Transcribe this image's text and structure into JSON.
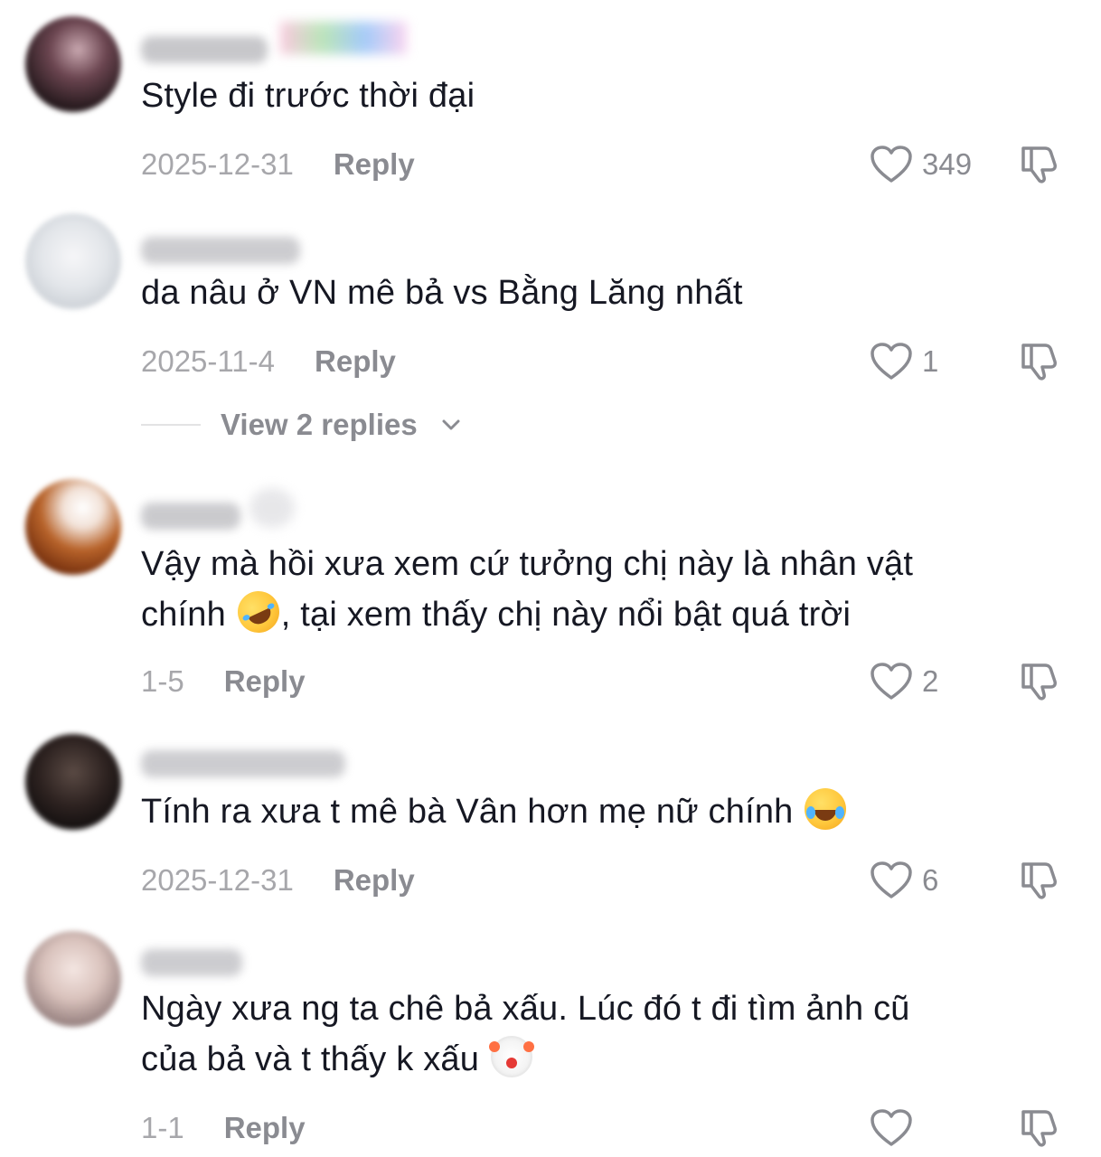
{
  "comments": [
    {
      "text": "Style đi trước thời đại",
      "date": "2025-12-31",
      "reply_label": "Reply",
      "likes": "349"
    },
    {
      "text": "da nâu ở VN mê bả vs Bằng Lăng nhất",
      "date": "2025-11-4",
      "reply_label": "Reply",
      "likes": "1",
      "view_replies": "View 2 replies"
    },
    {
      "text_line1": "Vậy mà hồi xưa xem cứ tưởng chị này là nhân vật",
      "text_line2a": "chính ",
      "text_line2b": ", tại xem thấy chị này nổi bật quá trời",
      "emoji": "rolling-on-floor-laughing",
      "date": "1-5",
      "reply_label": "Reply",
      "likes": "2"
    },
    {
      "text": "Tính ra xưa t mê bà Vân hơn mẹ nữ chính ",
      "emoji": "face-with-tears-of-joy",
      "date": "2025-12-31",
      "reply_label": "Reply",
      "likes": "6"
    },
    {
      "text_line1": "Ngày xưa ng ta chê bả xấu. Lúc đó t đi tìm ảnh cũ",
      "text_line2": "của bả và t thấy k xấu ",
      "emoji": "clown-face",
      "date": "1-1",
      "reply_label": "Reply",
      "likes": ""
    }
  ],
  "colors": {
    "text": "#161823",
    "secondary": "#8a8b91",
    "date": "#a7a7ab",
    "icon_stroke": "#8a8b91"
  },
  "icons": {
    "like": "heart-outline-icon",
    "dislike": "thumbs-down-outline-icon",
    "expand": "chevron-down-icon"
  }
}
